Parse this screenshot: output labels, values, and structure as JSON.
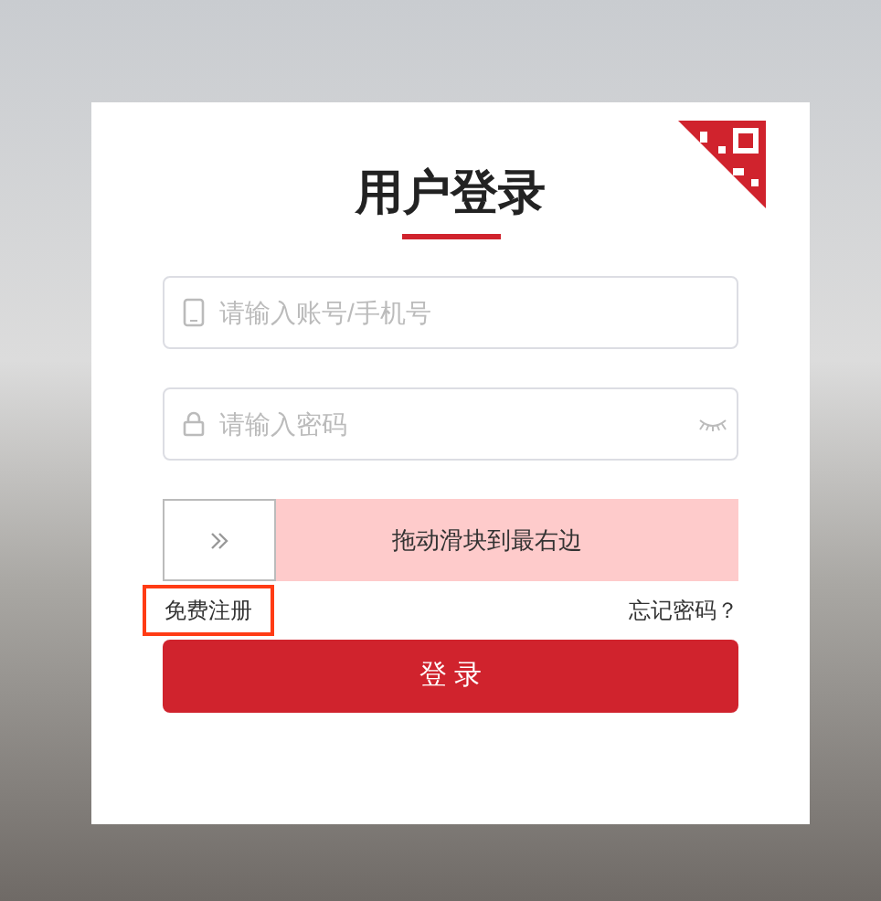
{
  "title": "用户登录",
  "fields": [
    {
      "kind": "account",
      "placeholder": "请输入账号/手机号"
    },
    {
      "kind": "password",
      "placeholder": "请输入密码"
    }
  ],
  "slider": {
    "label": "拖动滑块到最右边",
    "level": 0
  },
  "register_link": {
    "label": "免费注册",
    "highlighted": true
  },
  "forgot_link": {
    "label": "忘记密码？"
  },
  "login_button": {
    "label": "登 录"
  }
}
